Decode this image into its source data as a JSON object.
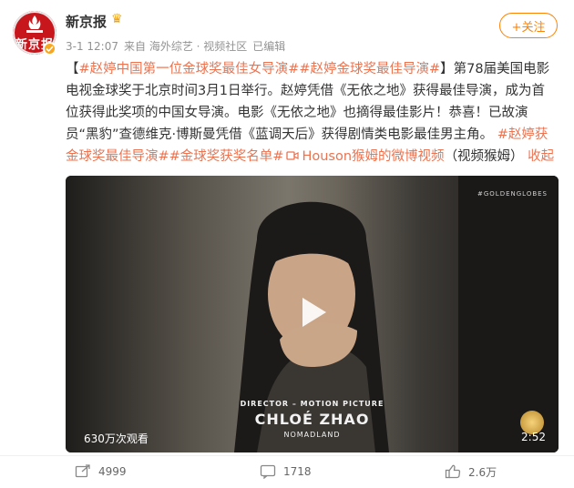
{
  "account": {
    "avatar_text": "新京报",
    "name": "新京报"
  },
  "meta": {
    "date": "3-1 12:07",
    "source": "来自 海外综艺 · 视频社区",
    "edited": "已编辑"
  },
  "follow": {
    "label": "+关注"
  },
  "post": {
    "bracket_open": "【",
    "tags": [
      "#赵婷中国第一位金球奖最佳女导演#",
      "#赵婷金球奖最佳导演#"
    ],
    "bracket_close": "】",
    "body": "第78届美国电影电视金球奖于北京时间3月1日举行。赵婷凭借《无依之地》获得最佳导演，成为首位获得此奖项的中国女导演。电影《无依之地》也摘得最佳影片！恭喜！已故演员“黑豹”查德维克·博斯曼凭借《蓝调天后》获得剧情类电影最佳男主角。",
    "tags2": [
      "#赵婷获金球奖最佳导演#",
      "#金球奖获奖名单#"
    ],
    "video_link": "Houson猴姆的微博视频",
    "video_source": "（视频猴姆）",
    "collapse": "收起"
  },
  "video": {
    "overlay_tag": "#GOLDENGLOBES",
    "role": "DIRECTOR – MOTION PICTURE",
    "winner": "CHLOÉ ZHAO",
    "film": "NOMADLAND",
    "views": "630万次观看",
    "duration": "2:52"
  },
  "actions": {
    "repost": "4999",
    "comment": "1718",
    "like": "2.6万"
  }
}
